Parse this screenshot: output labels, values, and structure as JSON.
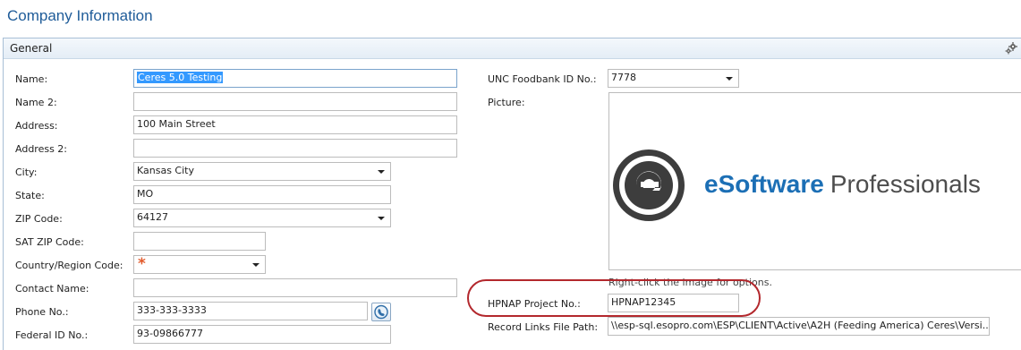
{
  "page_title": "Company Information",
  "section": {
    "title": "General"
  },
  "left_fields": [
    {
      "label": "Name:",
      "value": "Ceres 5.0 Testing"
    },
    {
      "label": "Name 2:",
      "value": ""
    },
    {
      "label": "Address:",
      "value": "100 Main Street"
    },
    {
      "label": "Address 2:",
      "value": ""
    },
    {
      "label": "City:",
      "value": "Kansas City"
    },
    {
      "label": "State:",
      "value": "MO"
    },
    {
      "label": "ZIP Code:",
      "value": "64127"
    },
    {
      "label": "SAT ZIP Code:",
      "value": ""
    },
    {
      "label": "Country/Region Code:",
      "value": "",
      "required_marker": "*"
    },
    {
      "label": "Contact Name:",
      "value": ""
    },
    {
      "label": "Phone No.:",
      "value": "333-333-3333"
    },
    {
      "label": "Federal ID No.:",
      "value": "93-09866777"
    }
  ],
  "right_fields": {
    "unc_foodbank": {
      "label": "UNC Foodbank ID No.:",
      "value": "7778"
    },
    "picture": {
      "label": "Picture:",
      "logo_text_bold": "eSoftware",
      "logo_text_regular": "Professionals",
      "hint": "Right-click the image for options."
    },
    "hpnap": {
      "label": "HPNAP Project No.:",
      "value": "HPNAP12345"
    },
    "record_links": {
      "label": "Record Links File Path:",
      "value": "\\\\esp-sql.esopro.com\\ESP\\CLIENT\\Active\\A2H (Feeding America) Ceres\\Versi..."
    }
  },
  "icons": {
    "section_options": "gear-icon",
    "phone_dial": "phone-icon"
  },
  "colors": {
    "title": "#1f5c99",
    "highlight_oval": "#b3282d",
    "selection": "#3399ff",
    "required": "#e25a2b"
  }
}
